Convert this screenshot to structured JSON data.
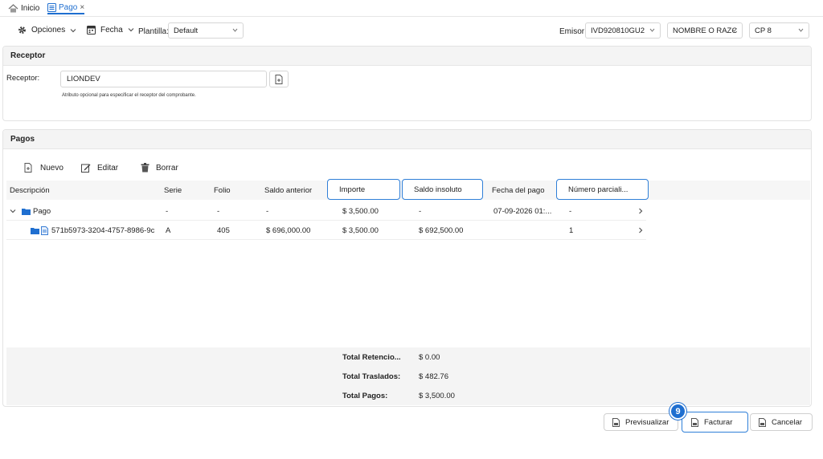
{
  "tabs": {
    "home_label": "Inicio",
    "active_label": "Pago",
    "close_glyph": "×"
  },
  "toolbar": {
    "options_label": "Opciones",
    "date_label": "Fecha",
    "template_label": "Plantilla:",
    "template_value": "Default",
    "issuer_label": "Emisor",
    "issuer_rfc": "IVD920810GU2",
    "issuer_name": "NOMBRE O RAZC",
    "cp_value": "CP 8"
  },
  "receptor": {
    "section_title": "Receptor",
    "field_label": "Receptor:",
    "field_value": "LIONDEV",
    "hint": "Atributo opcional para especificar el receptor del comprobante."
  },
  "pagos": {
    "section_title": "Pagos",
    "actions": {
      "new": "Nuevo",
      "edit": "Editar",
      "delete": "Borrar"
    },
    "columns": [
      "Descripción",
      "Serie",
      "Folio",
      "Saldo anterior",
      "Importe",
      "Saldo insoluto",
      "Fecha del pago",
      "Número parciali..."
    ],
    "rows": [
      {
        "descripcion": "Pago",
        "serie": "-",
        "folio": "-",
        "saldo_anterior": "-",
        "importe": "$ 3,500.00",
        "saldo_insoluto": "-",
        "fecha": "07-09-2026 01:...",
        "parcialidad": "-"
      },
      {
        "descripcion": "571b5973-3204-4757-8986-9c",
        "serie": "A",
        "folio": "405",
        "saldo_anterior": "$ 696,000.00",
        "importe": "$ 3,500.00",
        "saldo_insoluto": "$ 692,500.00",
        "fecha": "",
        "parcialidad": "1"
      }
    ],
    "totals": [
      {
        "label": "Total Retencio...",
        "value": "$ 0.00"
      },
      {
        "label": "Total Traslados:",
        "value": "$ 482.76"
      },
      {
        "label": "Total Pagos:",
        "value": "$ 3,500.00"
      }
    ]
  },
  "footer": {
    "preview_label": "Previsualizar",
    "invoice_label": "Facturar",
    "cancel_label": "Cancelar",
    "step_badge": "9"
  },
  "colors": {
    "accent": "#1f6fd0",
    "folder": "#1f6fd0"
  }
}
